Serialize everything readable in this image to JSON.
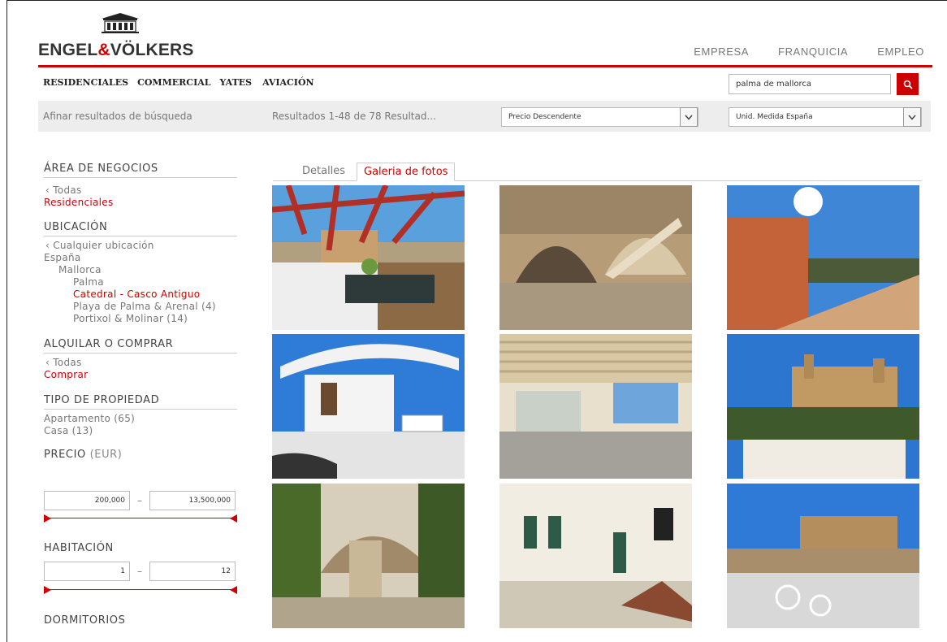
{
  "brand": {
    "pre": "ENGEL",
    "amp": "&",
    "post": "VÖLKERS"
  },
  "topnav": [
    "EMPRESA",
    "FRANQUICIA",
    "EMPLEO"
  ],
  "subnav": [
    "RESIDENCIALES",
    "COMMERCIAL",
    "YATES",
    "AVIACIÓN"
  ],
  "search": {
    "value": "palma de mallorca"
  },
  "filterbar": {
    "label": "Afinar resultados de búsqueda",
    "results": "Resultados 1-48 de 78 Resultad...",
    "sort": "Precio Descendente",
    "units": "Unid. Medida España"
  },
  "sidebar": {
    "area": {
      "title": "ÁREA DE NEGOCIOS",
      "back": "Todas",
      "selected": "Residenciales"
    },
    "ubicacion": {
      "title": "UBICACIÓN",
      "back": "Cualquier ubicación",
      "l1": "España",
      "l2": "Mallorca",
      "l3": "Palma",
      "selected": "Catedral - Casco Antiguo",
      "opt1": "Playa de Palma & Arenal (4)",
      "opt2": "Portixol & Molinar (14)"
    },
    "alquilar": {
      "title": "ALQUILAR O COMPRAR",
      "back": "Todas",
      "selected": "Comprar"
    },
    "tipo": {
      "title": "TIPO DE PROPIEDAD",
      "opt1": "Apartamento (65)",
      "opt2": "Casa (13)"
    },
    "precio": {
      "title": "PRECIO",
      "unit": "(EUR)",
      "min": "200,000",
      "max": "13,500,000"
    },
    "habitacion": {
      "title": "HABITACIÓN",
      "min": "1",
      "max": "12"
    },
    "dormitorios": {
      "title": "DORMITORIOS"
    }
  },
  "tabs": {
    "detalles": "Detalles",
    "galeria": "Galeria de fotos"
  },
  "colors": {
    "accent": "#cc0000",
    "filterbar": "#ededed"
  },
  "icons": [
    "logo-house-icon",
    "search-icon",
    "chevron-down-icon",
    "slider-handle-icon"
  ]
}
